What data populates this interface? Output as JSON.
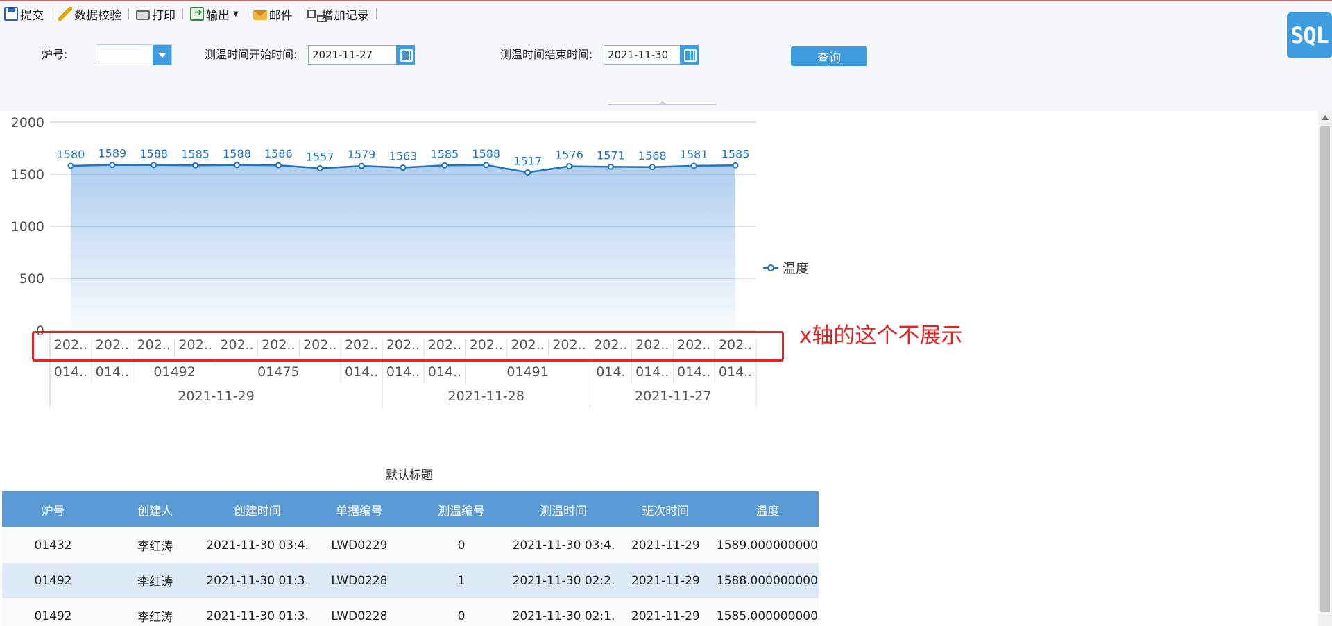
{
  "toolbar": {
    "submit": "提交",
    "validate": "数据校验",
    "print": "打印",
    "export": "输出",
    "mail": "邮件",
    "add_record": "增加记录"
  },
  "filter": {
    "furnace_label": "炉号:",
    "furnace_value": "",
    "start_label": "测温时间开始时间:",
    "start_value": "2021-11-27",
    "end_label": "测温时间结束时间:",
    "end_value": "2021-11-30",
    "query": "查询"
  },
  "sql_button": "SQL",
  "annotation": "x轴的这个不展示",
  "chart_data": {
    "type": "area",
    "y_ticks": [
      "2000",
      "1500",
      "1000",
      "500",
      "0"
    ],
    "ylim": [
      0,
      2000
    ],
    "grid": true,
    "legend": {
      "position": "right",
      "series_name": "温度"
    },
    "series": [
      {
        "name": "温度",
        "values": [
          1580,
          1589,
          1588,
          1585,
          1588,
          1586,
          1557,
          1579,
          1563,
          1585,
          1588,
          1517,
          1576,
          1571,
          1568,
          1581,
          1585
        ]
      }
    ],
    "axis_level1": [
      "202..",
      "202..",
      "202..",
      "202..",
      "202..",
      "202..",
      "202..",
      "202..",
      "202..",
      "202..",
      "202..",
      "202..",
      "202..",
      "202..",
      "202..",
      "202..",
      "202.."
    ],
    "axis_level2": [
      {
        "label": "014..",
        "span": 1
      },
      {
        "label": "014..",
        "span": 1
      },
      {
        "label": "01492",
        "span": 2
      },
      {
        "label": "01475",
        "span": 3
      },
      {
        "label": "014..",
        "span": 1
      },
      {
        "label": "014..",
        "span": 1
      },
      {
        "label": "014..",
        "span": 1
      },
      {
        "label": "01491",
        "span": 3
      },
      {
        "label": "014.",
        "span": 1
      },
      {
        "label": "014..",
        "span": 1
      },
      {
        "label": "014..",
        "span": 1
      },
      {
        "label": "014..",
        "span": 1
      }
    ],
    "axis_level3": [
      {
        "label": "2021-11-29",
        "span": 8
      },
      {
        "label": "2021-11-28",
        "span": 5
      },
      {
        "label": "2021-11-27",
        "span": 4
      }
    ]
  },
  "table": {
    "title": "默认标题",
    "headers": [
      "炉号",
      "创建人",
      "创建时间",
      "单据编号",
      "测温编号",
      "测温时间",
      "班次时间",
      "温度"
    ],
    "rows": [
      [
        "01432",
        "李红涛",
        "2021-11-30 03:4...",
        "LWD0229",
        "0",
        "2021-11-30 03:4...",
        "2021-11-29",
        "1589.0000000000"
      ],
      [
        "01492",
        "李红涛",
        "2021-11-30 01:3...",
        "LWD0228",
        "1",
        "2021-11-30 02:2...",
        "2021-11-29",
        "1588.0000000000"
      ],
      [
        "01492",
        "李红涛",
        "2021-11-30 01:3...",
        "LWD0228",
        "0",
        "2021-11-30 02:1...",
        "2021-11-29",
        "1585.0000000000"
      ]
    ]
  },
  "colors": {
    "accent": "#3f9be0",
    "series": "#1e74c6",
    "header": "#5b9bd5",
    "annotation": "#e52323"
  }
}
